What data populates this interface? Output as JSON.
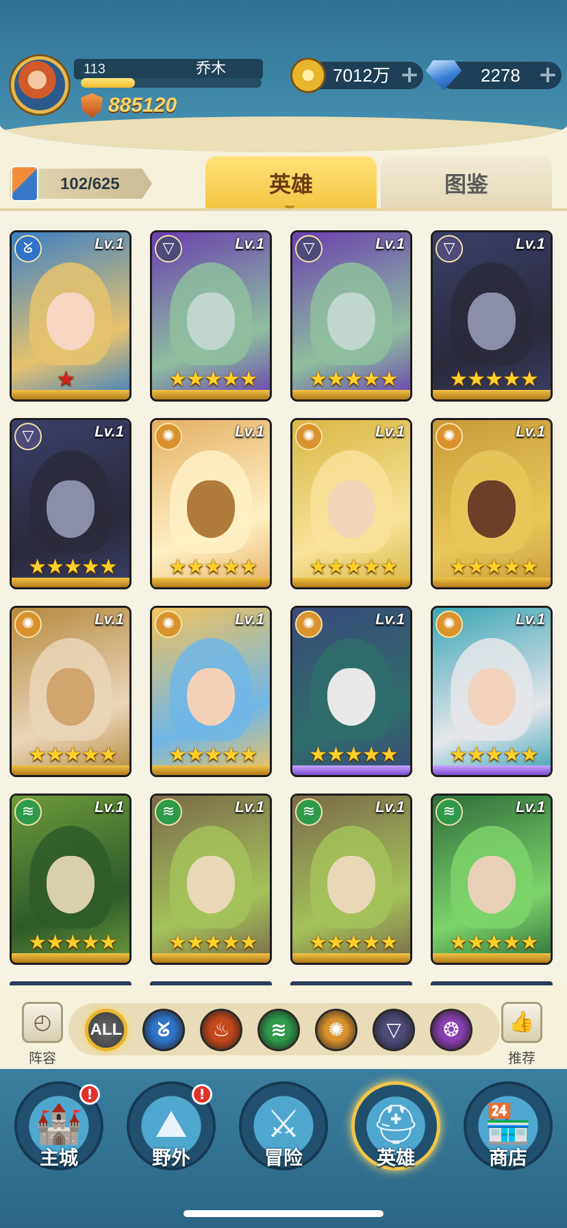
{
  "header": {
    "level": "113",
    "player_name": "乔木",
    "power": "885120",
    "xp_progress": 0.3,
    "gold": "7012万",
    "diamonds": "2278"
  },
  "collection": {
    "count": "102/625"
  },
  "tabs": [
    {
      "label": "英雄",
      "active": true
    },
    {
      "label": "图鉴",
      "active": false
    }
  ],
  "heroes": [
    {
      "level": "Lv.1",
      "faction": "water",
      "stars": 1,
      "star_color": "#d92020",
      "frame": "gold",
      "colors": [
        "#3b7fc4",
        "#e6c36e",
        "#f4d6c2"
      ]
    },
    {
      "level": "Lv.1",
      "faction": "dark",
      "stars": 5,
      "frame": "gold",
      "colors": [
        "#6a3fb0",
        "#8fbf9f",
        "#c2d6d0"
      ]
    },
    {
      "level": "Lv.1",
      "faction": "dark",
      "stars": 5,
      "frame": "gold",
      "colors": [
        "#6a3fb0",
        "#8fbf9f",
        "#c2d6d0"
      ]
    },
    {
      "level": "Lv.1",
      "faction": "dark",
      "stars": 5,
      "frame": "gold",
      "colors": [
        "#3a3f68",
        "#2a2a3a",
        "#8a8ea8"
      ]
    },
    {
      "level": "Lv.1",
      "faction": "dark",
      "stars": 5,
      "frame": "gold",
      "colors": [
        "#3a3f68",
        "#2a2a3a",
        "#8a8ea8"
      ]
    },
    {
      "level": "Lv.1",
      "faction": "light",
      "stars": 5,
      "frame": "gold",
      "colors": [
        "#e5b064",
        "#fff1c4",
        "#b07a3a"
      ]
    },
    {
      "level": "Lv.1",
      "faction": "light",
      "stars": 5,
      "frame": "gold",
      "colors": [
        "#d9b845",
        "#f7e29a",
        "#f0d5b8"
      ]
    },
    {
      "level": "Lv.1",
      "faction": "light",
      "stars": 5,
      "frame": "gold",
      "colors": [
        "#c89a3a",
        "#e9c75a",
        "#6a4128"
      ]
    },
    {
      "level": "Lv.1",
      "faction": "light",
      "stars": 5,
      "frame": "gold",
      "colors": [
        "#b58a3e",
        "#e9d6b8",
        "#d2a46e"
      ]
    },
    {
      "level": "Lv.1",
      "faction": "light",
      "stars": 5,
      "frame": "gold",
      "colors": [
        "#f2c35c",
        "#6fb6e8",
        "#f3d0b8"
      ]
    },
    {
      "level": "Lv.1",
      "faction": "light",
      "stars": 5,
      "frame": "purple",
      "colors": [
        "#3a4a7a",
        "#2e6e6a",
        "#e8e8e8"
      ]
    },
    {
      "level": "Lv.1",
      "faction": "light",
      "stars": 5,
      "frame": "purple",
      "colors": [
        "#3aa6b5",
        "#e6e6ea",
        "#f1d2be"
      ]
    },
    {
      "level": "Lv.1",
      "faction": "nature",
      "stars": 5,
      "frame": "gold",
      "colors": [
        "#6f9a3a",
        "#2f5a2a",
        "#d8d0a8"
      ]
    },
    {
      "level": "Lv.1",
      "faction": "nature",
      "stars": 5,
      "frame": "gold",
      "colors": [
        "#7a6a4a",
        "#a5c25a",
        "#e9d8b8"
      ]
    },
    {
      "level": "Lv.1",
      "faction": "nature",
      "stars": 5,
      "frame": "gold",
      "colors": [
        "#7a6a4a",
        "#a5c25a",
        "#e9d8b8"
      ]
    },
    {
      "level": "Lv.1",
      "faction": "nature",
      "stars": 5,
      "frame": "gold",
      "colors": [
        "#2e6e3a",
        "#7cd46a",
        "#e8d0b8"
      ]
    }
  ],
  "factions": {
    "water": {
      "icon": "water-icon",
      "glyph": "ᘜ",
      "color": "#2f74c9"
    },
    "fire": {
      "icon": "fire-icon",
      "glyph": "♨",
      "color": "#c4481c"
    },
    "nature": {
      "icon": "nature-icon",
      "glyph": "≋",
      "color": "#2f9a4a"
    },
    "light": {
      "icon": "light-icon",
      "glyph": "✺",
      "color": "#d9922e"
    },
    "dark": {
      "icon": "dark-icon",
      "glyph": "▽",
      "color": "#4e4a7a"
    },
    "arcane": {
      "icon": "arcane-icon",
      "glyph": "❂",
      "color": "#8a3fb0"
    }
  },
  "filter": {
    "lineup_label": "阵容",
    "all_label": "ALL",
    "recommend_label": "推荐",
    "items": [
      "water",
      "fire",
      "nature",
      "light",
      "dark",
      "arcane"
    ]
  },
  "nav": [
    {
      "label": "主城",
      "icon": "castle-icon",
      "glyph": "🏰",
      "badge": "!"
    },
    {
      "label": "野外",
      "icon": "wilds-icon",
      "glyph": "⛰",
      "badge": "!"
    },
    {
      "label": "冒险",
      "icon": "sword-icon",
      "glyph": "⚔",
      "badge": ""
    },
    {
      "label": "英雄",
      "icon": "helmet-icon",
      "glyph": "⛑",
      "badge": "",
      "active": true
    },
    {
      "label": "商店",
      "icon": "shop-icon",
      "glyph": "🏪",
      "badge": ""
    }
  ]
}
